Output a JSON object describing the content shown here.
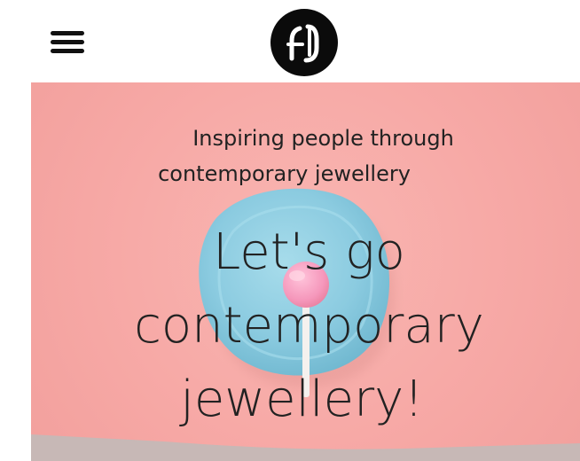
{
  "header": {
    "menu_icon": "hamburger-menu-icon",
    "logo_icon": "brand-monogram-logo-icon"
  },
  "hero": {
    "tagline_line1": "Inspiring people through",
    "tagline_line2": "contemporary jewellery",
    "headline_line1": "Let's go",
    "headline_line2": "contemporary",
    "headline_line3": "jewellery!",
    "background_color": "#f7a9a6",
    "plate_color": "#87c8dc",
    "candy_color": "#f59bbd"
  }
}
